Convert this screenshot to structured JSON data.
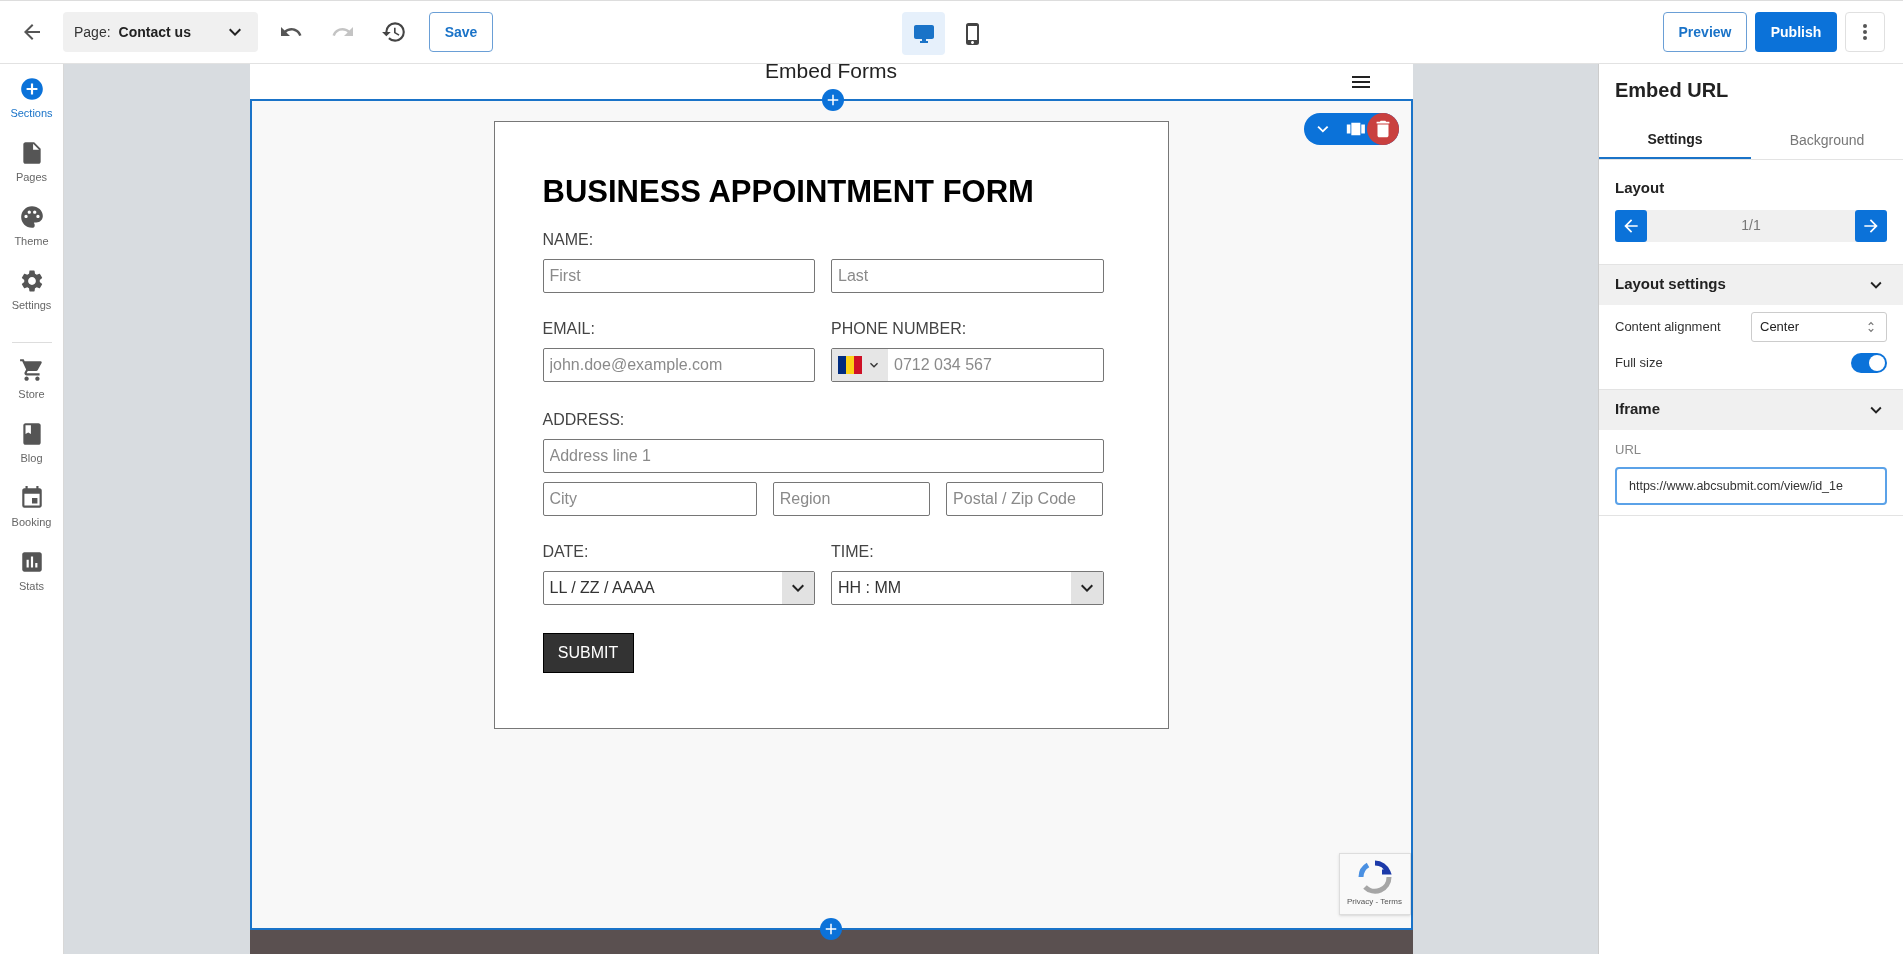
{
  "toolbar": {
    "page_label": "Page:",
    "page_name": "Contact us",
    "undo": {
      "disabled": false
    },
    "redo": {
      "disabled": true
    },
    "save": "Save",
    "devices": [
      {
        "selected": true
      },
      {
        "selected": false
      }
    ],
    "preview": "Preview",
    "publish": "Publish"
  },
  "sidebar": {
    "groups": [
      [
        {
          "label": "Sections",
          "selected": true
        },
        {
          "label": "Pages",
          "selected": false
        },
        {
          "label": "Theme",
          "selected": false
        },
        {
          "label": "Settings",
          "selected": false
        }
      ],
      [
        {
          "label": "Store",
          "selected": false
        },
        {
          "label": "Blog",
          "selected": false
        },
        {
          "label": "Booking",
          "selected": false
        },
        {
          "label": "Stats",
          "selected": false
        }
      ]
    ]
  },
  "site_header": {
    "title": "Embed Forms"
  },
  "form": {
    "title": "BUSINESS APPOINTMENT FORM",
    "blocks": [
      {
        "kind": "group",
        "label": "NAME:",
        "lines": [
          [
            {
              "kind": "text",
              "placeholder": "First"
            },
            {
              "kind": "text",
              "placeholder": "Last"
            }
          ]
        ]
      },
      {
        "kind": "columns",
        "columns": [
          {
            "label": "EMAIL:",
            "field": {
              "kind": "text",
              "placeholder": "john.doe@example.com"
            }
          },
          {
            "label": "PHONE NUMBER:",
            "field": {
              "kind": "phone",
              "placeholder": "0712 034 567"
            }
          }
        ]
      },
      {
        "kind": "group",
        "label": "ADDRESS:",
        "lines": [
          [
            {
              "kind": "text",
              "placeholder": "Address line 1"
            }
          ],
          [
            {
              "kind": "text",
              "placeholder": "City"
            },
            {
              "kind": "text",
              "placeholder": "Region"
            },
            {
              "kind": "text",
              "placeholder": "Postal / Zip Code"
            }
          ]
        ]
      },
      {
        "kind": "columns",
        "columns": [
          {
            "label": "DATE:",
            "field": {
              "kind": "select",
              "value": "LL / ZZ / AAAA"
            }
          },
          {
            "label": "TIME:",
            "field": {
              "kind": "select",
              "value": "HH : MM"
            }
          }
        ]
      }
    ],
    "submit": "SUBMIT"
  },
  "recaptcha": {
    "text": "Privacy - Terms"
  },
  "panel": {
    "title": "Embed URL",
    "tabs": [
      {
        "label": "Settings",
        "selected": true
      },
      {
        "label": "Background",
        "selected": false
      }
    ],
    "layout": {
      "title": "Layout",
      "pager": "1/1"
    },
    "layout_settings": {
      "title": "Layout settings",
      "expanded": true,
      "content_alignment": {
        "label": "Content alignment",
        "value": "Center"
      },
      "full_size": {
        "label": "Full size",
        "on": true
      }
    },
    "iframe": {
      "title": "Iframe",
      "expanded": true,
      "url_label": "URL",
      "url": "https://www.abcsubmit.com/view/id_1e"
    }
  }
}
